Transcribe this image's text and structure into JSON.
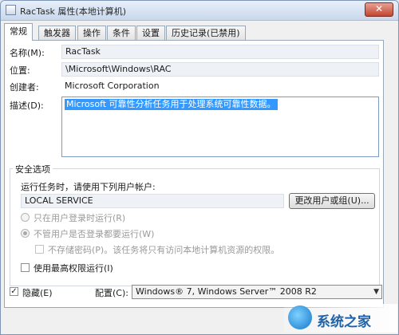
{
  "window": {
    "title": "RacTask 属性(本地计算机)",
    "close_symbol": "✕"
  },
  "tabs": [
    {
      "label": "常规"
    },
    {
      "label": "触发器"
    },
    {
      "label": "操作"
    },
    {
      "label": "条件"
    },
    {
      "label": "设置"
    },
    {
      "label": "历史记录(已禁用)"
    }
  ],
  "general": {
    "name_label": "名称(M):",
    "name_value": "RacTask",
    "location_label": "位置:",
    "location_value": "\\Microsoft\\Windows\\RAC",
    "author_label": "创建者:",
    "author_value": "Microsoft Corporation",
    "description_label": "描述(D):",
    "description_value": "Microsoft 可靠性分析任务用于处理系统可靠性数据。"
  },
  "security": {
    "legend": "安全选项",
    "run_as_prompt": "运行任务时，请使用下列用户帐户:",
    "user_account": "LOCAL SERVICE",
    "change_user_button": "更改用户或组(U)...",
    "option_logged_on": "只在用户登录时运行(R)",
    "option_any": "不管用户是否登录都要运行(W)",
    "do_not_store_password": "不存储密码(P)。该任务将只有访问本地计算机资源的权限。",
    "highest_privileges": "使用最高权限运行(I)"
  },
  "footer": {
    "hidden_label": "隐藏(E)",
    "hidden_check": "✓",
    "configure_label": "配置(C):",
    "configure_value": "Windows® 7, Windows Server™ 2008 R2",
    "dropdown_arrow": "▼"
  },
  "watermark": {
    "text": "系统之家"
  }
}
